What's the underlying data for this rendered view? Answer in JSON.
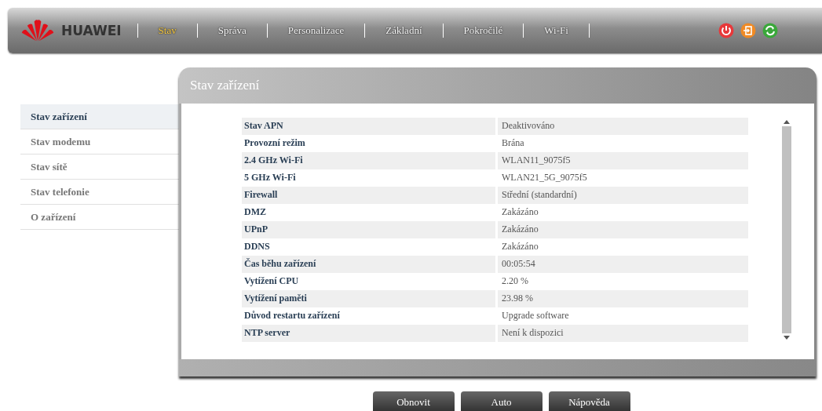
{
  "header": {
    "logo_text": "HUAWEI",
    "nav": [
      {
        "label": "Stav",
        "selected": true
      },
      {
        "label": "Správa",
        "selected": false
      },
      {
        "label": "Personalizace",
        "selected": false
      },
      {
        "label": "Základní",
        "selected": false
      },
      {
        "label": "Pokročilé",
        "selected": false
      },
      {
        "label": "Wi-Fi",
        "selected": false
      }
    ]
  },
  "sidebar": {
    "items": [
      {
        "label": "Stav zařízení",
        "selected": true
      },
      {
        "label": "Stav modemu",
        "selected": false
      },
      {
        "label": "Stav sítě",
        "selected": false
      },
      {
        "label": "Stav telefonie",
        "selected": false
      },
      {
        "label": "O zařízení",
        "selected": false
      }
    ]
  },
  "panel": {
    "title": "Stav zařízení",
    "rows": [
      {
        "label": "Stav APN",
        "value": "Deaktivováno"
      },
      {
        "label": "Provozní režim",
        "value": "Brána"
      },
      {
        "label": "2.4 GHz Wi-Fi",
        "value": "WLAN11_9075f5"
      },
      {
        "label": "5 GHz Wi-Fi",
        "value": "WLAN21_5G_9075f5"
      },
      {
        "label": "Firewall",
        "value": "Střední (standardní)"
      },
      {
        "label": "DMZ",
        "value": "Zakázáno"
      },
      {
        "label": "UPnP",
        "value": "Zakázáno"
      },
      {
        "label": "DDNS",
        "value": "Zakázáno"
      },
      {
        "label": "Čas běhu zařízení",
        "value": "00:05:54"
      },
      {
        "label": "Vytížení CPU",
        "value": "2.20 %"
      },
      {
        "label": "Vytížení paměti",
        "value": "23.98 %"
      },
      {
        "label": "Důvod restartu zařízení",
        "value": "Upgrade software"
      },
      {
        "label": "NTP server",
        "value": "Není k dispozici"
      }
    ]
  },
  "buttons": [
    "Obnovit",
    "Auto",
    "Nápověda"
  ]
}
